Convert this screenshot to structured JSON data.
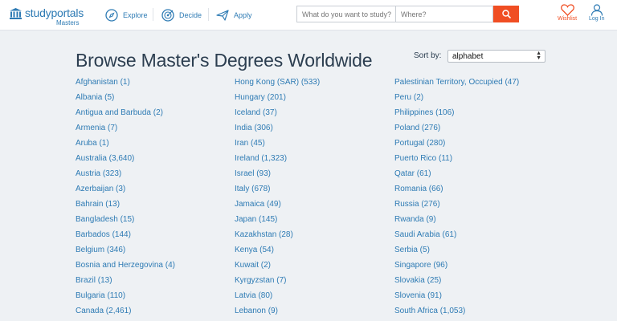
{
  "header": {
    "logo": {
      "name": "studyportals",
      "sub": "Masters"
    },
    "nav": [
      {
        "label": "Explore",
        "icon": "compass-icon"
      },
      {
        "label": "Decide",
        "icon": "target-icon"
      },
      {
        "label": "Apply",
        "icon": "paper-plane-icon"
      }
    ],
    "search": {
      "what_placeholder": "What do you want to study?",
      "where_placeholder": "Where?",
      "button_icon": "search-icon"
    },
    "wishlist_label": "Wishlist",
    "login_label": "Log In",
    "accent": "#f04e23",
    "link_color": "#2e7bb4"
  },
  "main": {
    "title": "Browse Master's Degrees Worldwide",
    "sort": {
      "label": "Sort by:",
      "selected": "alphabet"
    },
    "columns": [
      [
        "Afghanistan (1)",
        "Albania (5)",
        "Antigua and Barbuda (2)",
        "Armenia (7)",
        "Aruba (1)",
        "Australia (3,640)",
        "Austria (323)",
        "Azerbaijan (3)",
        "Bahrain (13)",
        "Bangladesh (15)",
        "Barbados (144)",
        "Belgium (346)",
        "Bosnia and Herzegovina (4)",
        "Brazil (13)",
        "Bulgaria (110)",
        "Canada (2,461)"
      ],
      [
        "Hong Kong (SAR) (533)",
        "Hungary (201)",
        "Iceland (37)",
        "India (306)",
        "Iran (45)",
        "Ireland (1,323)",
        "Israel (93)",
        "Italy (678)",
        "Jamaica (49)",
        "Japan (145)",
        "Kazakhstan (28)",
        "Kenya (54)",
        "Kuwait (2)",
        "Kyrgyzstan (7)",
        "Latvia (80)",
        "Lebanon (9)"
      ],
      [
        "Palestinian Territory, Occupied (47)",
        "Peru (2)",
        "Philippines (106)",
        "Poland (276)",
        "Portugal (280)",
        "Puerto Rico (11)",
        "Qatar (61)",
        "Romania (66)",
        "Russia (276)",
        "Rwanda (9)",
        "Saudi Arabia (61)",
        "Serbia (5)",
        "Singapore (96)",
        "Slovakia (25)",
        "Slovenia (91)",
        "South Africa (1,053)"
      ]
    ]
  }
}
